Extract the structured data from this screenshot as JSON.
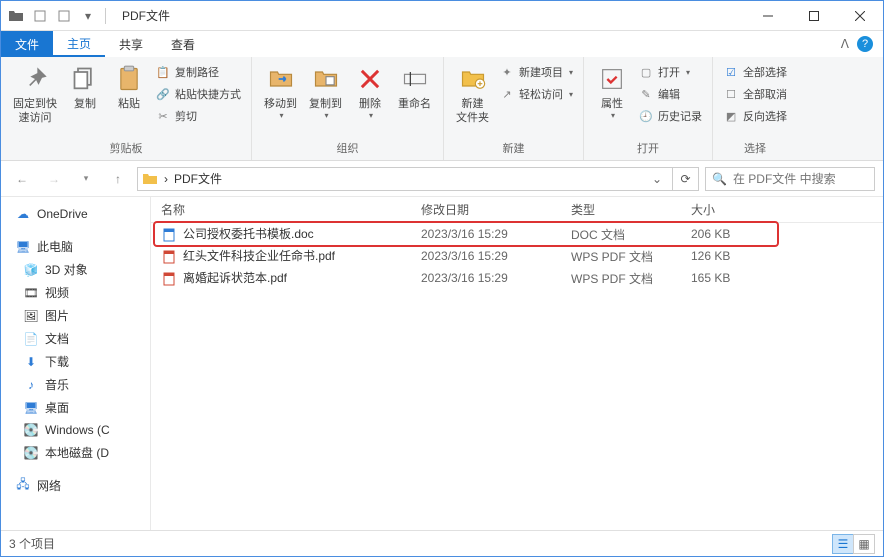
{
  "window": {
    "title": "PDF文件"
  },
  "tabs": {
    "file": "文件",
    "home": "主页",
    "share": "共享",
    "view": "查看"
  },
  "ribbon": {
    "pin": "固定到快\n速访问",
    "copy": "复制",
    "paste": "粘贴",
    "cut": "剪切",
    "copy_path": "复制路径",
    "paste_shortcut": "粘贴快捷方式",
    "group_clipboard": "剪贴板",
    "move_to": "移动到",
    "copy_to": "复制到",
    "delete": "删除",
    "rename": "重命名",
    "group_organize": "组织",
    "new_folder": "新建\n文件夹",
    "new_item": "新建项目",
    "easy_access": "轻松访问",
    "group_new": "新建",
    "properties": "属性",
    "open": "打开",
    "edit": "编辑",
    "history": "历史记录",
    "group_open": "打开",
    "select_all": "全部选择",
    "select_none": "全部取消",
    "invert_sel": "反向选择",
    "group_select": "选择"
  },
  "breadcrumb": {
    "chevron": "›",
    "current": "PDF文件"
  },
  "search": {
    "placeholder": "在 PDF文件 中搜索"
  },
  "nav": {
    "onedrive": "OneDrive",
    "this_pc": "此电脑",
    "objects3d": "3D 对象",
    "videos": "视频",
    "pictures": "图片",
    "documents": "文档",
    "downloads": "下载",
    "music": "音乐",
    "desktop": "桌面",
    "windows_c": "Windows (C",
    "local_d": "本地磁盘 (D",
    "network": "网络"
  },
  "columns": {
    "name": "名称",
    "date": "修改日期",
    "type": "类型",
    "size": "大小"
  },
  "files": [
    {
      "name": "公司授权委托书模板.doc",
      "date": "2023/3/16 15:29",
      "type": "DOC 文档",
      "size": "206 KB",
      "kind": "doc"
    },
    {
      "name": "红头文件科技企业任命书.pdf",
      "date": "2023/3/16 15:29",
      "type": "WPS PDF 文档",
      "size": "126 KB",
      "kind": "pdf"
    },
    {
      "name": "离婚起诉状范本.pdf",
      "date": "2023/3/16 15:29",
      "type": "WPS PDF 文档",
      "size": "165 KB",
      "kind": "pdf"
    }
  ],
  "status": {
    "count": "3 个项目"
  }
}
